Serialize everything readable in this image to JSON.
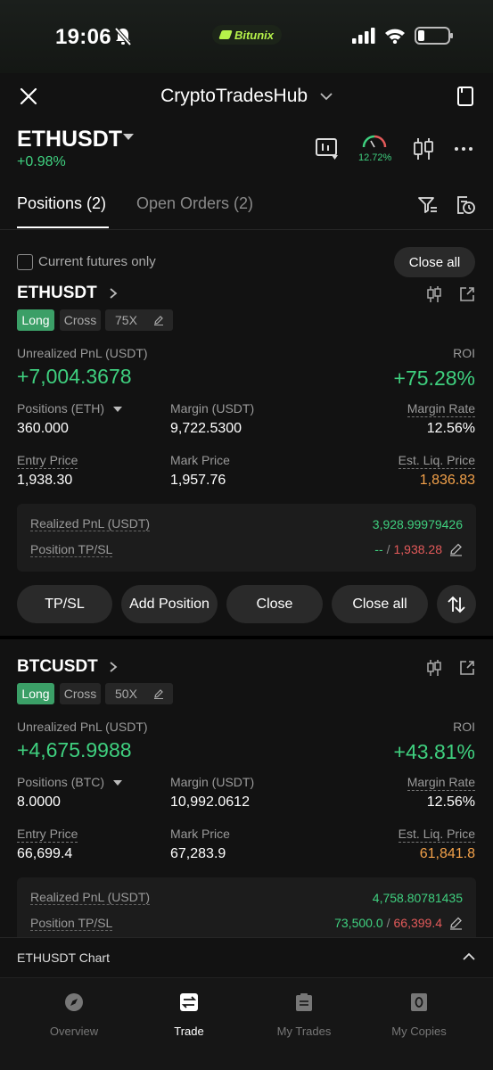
{
  "status": {
    "time": "19:06",
    "brand": "Bitunix"
  },
  "header": {
    "title": "CryptoTradesHub"
  },
  "pair": {
    "symbol": "ETHUSDT",
    "change": "+0.98%",
    "gauge_value": "12.72%"
  },
  "tabs": [
    {
      "label": "Positions (2)"
    },
    {
      "label": "Open Orders (2)"
    }
  ],
  "filter": {
    "current_futures_label": "Current futures only",
    "close_all_label": "Close all"
  },
  "positions": [
    {
      "symbol": "ETHUSDT",
      "side": "Long",
      "margin_mode": "Cross",
      "leverage": "75X",
      "upnl_label": "Unrealized PnL (USDT)",
      "upnl": "+7,004.3678",
      "roi_label": "ROI",
      "roi": "+75.28%",
      "size_label": "Positions (ETH)",
      "size": "360.000",
      "margin_label": "Margin (USDT)",
      "margin": "9,722.5300",
      "margin_rate_label": "Margin Rate",
      "margin_rate": "12.56%",
      "entry_label": "Entry Price",
      "entry": "1,938.30",
      "mark_label": "Mark Price",
      "mark": "1,957.76",
      "liq_label": "Est. Liq. Price",
      "liq": "1,836.83",
      "realized_label": "Realized PnL (USDT)",
      "realized": "3,928.99979426",
      "tpsl_label": "Position TP/SL",
      "tp": "--",
      "sl": "1,938.28"
    },
    {
      "symbol": "BTCUSDT",
      "side": "Long",
      "margin_mode": "Cross",
      "leverage": "50X",
      "upnl_label": "Unrealized PnL (USDT)",
      "upnl": "+4,675.9988",
      "roi_label": "ROI",
      "roi": "+43.81%",
      "size_label": "Positions (BTC)",
      "size": "8.0000",
      "margin_label": "Margin (USDT)",
      "margin": "10,992.0612",
      "margin_rate_label": "Margin Rate",
      "margin_rate": "12.56%",
      "entry_label": "Entry Price",
      "entry": "66,699.4",
      "mark_label": "Mark Price",
      "mark": "67,283.9",
      "liq_label": "Est. Liq. Price",
      "liq": "61,841.8",
      "realized_label": "Realized PnL (USDT)",
      "realized": "4,758.80781435",
      "tpsl_label": "Position TP/SL",
      "tp": "73,500.0",
      "sl": "66,399.4"
    }
  ],
  "actions": {
    "tpsl": "TP/SL",
    "add": "Add Position",
    "close": "Close",
    "close_all": "Close all"
  },
  "tpsl_sep": "/",
  "chart_bar": {
    "label": "ETHUSDT Chart"
  },
  "nav": [
    {
      "label": "Overview"
    },
    {
      "label": "Trade"
    },
    {
      "label": "My Trades"
    },
    {
      "label": "My Copies"
    }
  ],
  "colors": {
    "green": "#3fd07f",
    "red": "#e35a5a",
    "orange": "#f2a14a",
    "long_badge": "#3b9f67",
    "brand": "#b6f24a"
  }
}
